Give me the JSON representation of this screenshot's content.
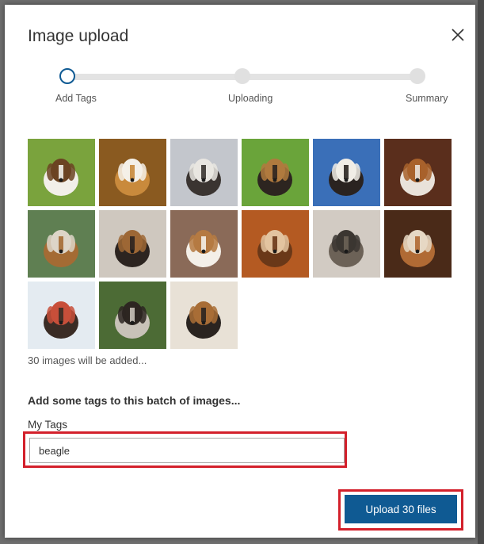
{
  "dialog": {
    "title": "Image upload",
    "close_icon": "close-icon"
  },
  "stepper": {
    "current_step": 0,
    "steps": [
      {
        "label": "Add Tags",
        "state": "active"
      },
      {
        "label": "Uploading",
        "state": "pending"
      },
      {
        "label": "Summary",
        "state": "pending"
      }
    ]
  },
  "thumbnails": [
    {
      "name": "beagle-photo-1",
      "palette": [
        "#7aa33d",
        "#f2efe9",
        "#6b4322"
      ]
    },
    {
      "name": "beagle-photo-2",
      "palette": [
        "#8a5a20",
        "#c98a3c",
        "#f4f0e8"
      ]
    },
    {
      "name": "beagle-photo-3",
      "palette": [
        "#c3c6cc",
        "#3a3431",
        "#e9e6e1"
      ]
    },
    {
      "name": "beagle-photo-4",
      "palette": [
        "#6aa43a",
        "#2d2520",
        "#b07a3e"
      ]
    },
    {
      "name": "beagle-photo-5",
      "palette": [
        "#3a6fb8",
        "#2a2320",
        "#f1ede6"
      ]
    },
    {
      "name": "beagle-photo-6",
      "palette": [
        "#5a2e1c",
        "#e9e2da",
        "#a8612b"
      ]
    },
    {
      "name": "beagle-photo-7",
      "palette": [
        "#5f7f52",
        "#a46b34",
        "#ddd5c8"
      ]
    },
    {
      "name": "beagle-photo-8",
      "palette": [
        "#cfc8bf",
        "#2c2420",
        "#9d6735"
      ]
    },
    {
      "name": "beagle-photo-9",
      "palette": [
        "#8a6a58",
        "#f4efe8",
        "#b57a42"
      ]
    },
    {
      "name": "beagle-photo-10",
      "palette": [
        "#b45a22",
        "#6a3818",
        "#e3c4a0"
      ]
    },
    {
      "name": "beagle-photo-11",
      "palette": [
        "#d2cbc3",
        "#6c6257",
        "#3b3631"
      ]
    },
    {
      "name": "beagle-photo-12",
      "palette": [
        "#4a2a18",
        "#b06a34",
        "#e6d8c4"
      ]
    },
    {
      "name": "beagle-photo-13",
      "palette": [
        "#e4ebf1",
        "#3a2c25",
        "#c84f3a"
      ]
    },
    {
      "name": "beagle-photo-14",
      "palette": [
        "#4c6b35",
        "#c8c2b8",
        "#2d2621"
      ]
    },
    {
      "name": "beagle-photo-15",
      "palette": [
        "#e8e1d6",
        "#2a2420",
        "#a86d36"
      ]
    }
  ],
  "summary_text": "30 images will be added...",
  "tags_section": {
    "heading": "Add some tags to this batch of images...",
    "field_label": "My Tags",
    "value": "beagle"
  },
  "upload_button": {
    "label": "Upload 30 files"
  },
  "colors": {
    "accent": "#0f5a93",
    "highlight": "#d3202b",
    "track": "#e3e3e3"
  }
}
